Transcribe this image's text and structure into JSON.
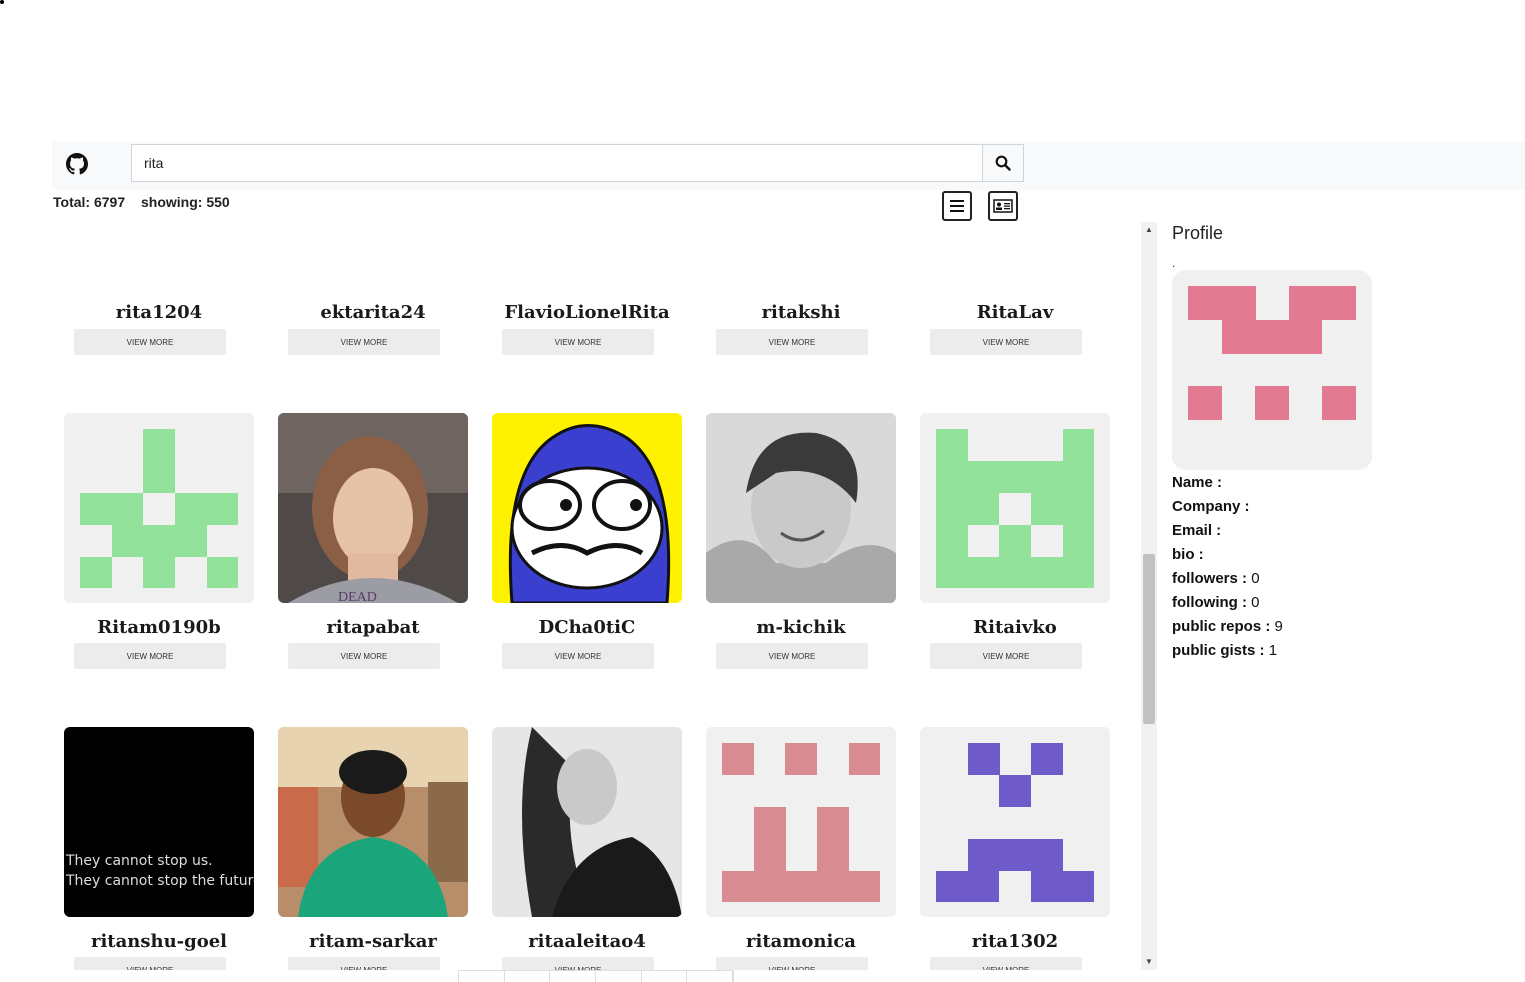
{
  "search": {
    "value": "rita"
  },
  "stats": {
    "total_label": "Total: 6797",
    "showing_label": "showing: 550"
  },
  "grid": {
    "row1": [
      {
        "name": "rita1204",
        "button": "VIEW MORE"
      },
      {
        "name": "ektarita24",
        "button": "VIEW MORE"
      },
      {
        "name": "FlavioLionelRita",
        "button": "VIEW MORE"
      },
      {
        "name": "ritakshi",
        "button": "VIEW MORE"
      },
      {
        "name": "RitaLav",
        "button": "VIEW MORE"
      }
    ],
    "row2": [
      {
        "name": "Ritam0190b",
        "button": "VIEW MORE"
      },
      {
        "name": "ritapabat",
        "button": "VIEW MORE"
      },
      {
        "name": "DCha0tiC",
        "button": "VIEW MORE"
      },
      {
        "name": "m-kichik",
        "button": "VIEW MORE"
      },
      {
        "name": "Ritaivko",
        "button": "VIEW MORE"
      }
    ],
    "row3": [
      {
        "name": "ritanshu-goel",
        "button": "VIEW MORE",
        "avatar_text_1": "They cannot stop us.",
        "avatar_text_2": "They cannot stop the future!"
      },
      {
        "name": "ritam-sarkar",
        "button": "VIEW MORE"
      },
      {
        "name": "ritaaleitao4",
        "button": "VIEW MORE"
      },
      {
        "name": "ritamonica",
        "button": "VIEW MORE"
      },
      {
        "name": "rita1302",
        "button": "VIEW MORE"
      }
    ]
  },
  "colors": {
    "green": "#92e29c",
    "pink": "#e27b92",
    "rose": "#d98b92",
    "purple": "#6e5ac8",
    "yellow": "#fff200",
    "blue": "#3b3fcf"
  },
  "profile": {
    "title": "Profile",
    "dot": ".",
    "name_label": "Name :",
    "name_value": "",
    "company_label": "Company :",
    "company_value": "",
    "email_label": "Email :",
    "email_value": "",
    "bio_label": "bio :",
    "bio_value": "",
    "followers_label": "followers :",
    "followers_value": "0",
    "following_label": "following :",
    "following_value": "0",
    "repos_label": "public repos :",
    "repos_value": "9",
    "gists_label": "public gists :",
    "gists_value": "1"
  }
}
